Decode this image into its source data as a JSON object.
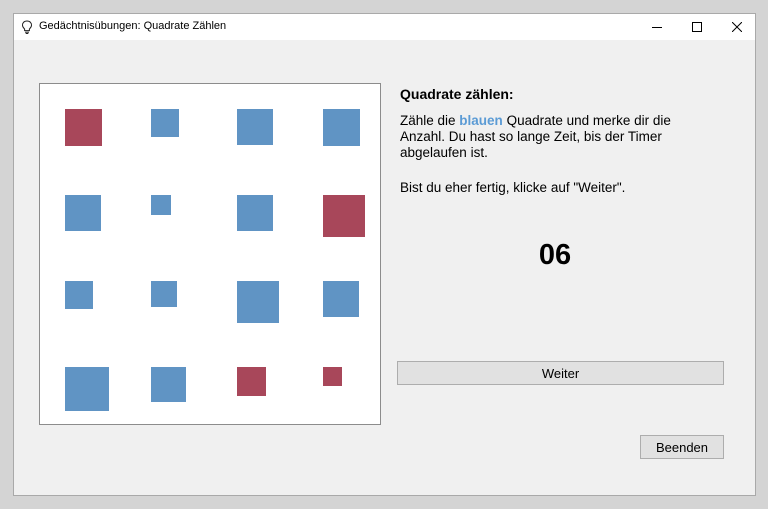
{
  "window": {
    "title": "Gedächtnisübungen: Quadrate Zählen",
    "controls": [
      "minimize",
      "maximize",
      "close"
    ]
  },
  "panel": {
    "heading": "Quadrate zählen:",
    "instruction_prefix": "Zähle die ",
    "instruction_keyword": "blauen",
    "instruction_suffix": " Quadrate und merke dir die Anzahl. Du hast so lange Zeit, bis der Timer abgelaufen ist.",
    "hint": "Bist du eher fertig, klicke auf \"Weiter\".",
    "timer": "06"
  },
  "buttons": {
    "next_label": "Weiter",
    "quit_label": "Beenden"
  },
  "colors": {
    "blue_square": "#6094c4",
    "red_square": "#a8475a",
    "keyword": "#5b9bd5"
  },
  "grid": {
    "rows": 4,
    "cols": 4,
    "squares": [
      [
        "red",
        "blue",
        "blue",
        "blue"
      ],
      [
        "blue",
        "blue",
        "blue",
        "red"
      ],
      [
        "blue",
        "blue",
        "blue",
        "blue"
      ],
      [
        "blue",
        "blue",
        "red",
        "red"
      ]
    ]
  }
}
